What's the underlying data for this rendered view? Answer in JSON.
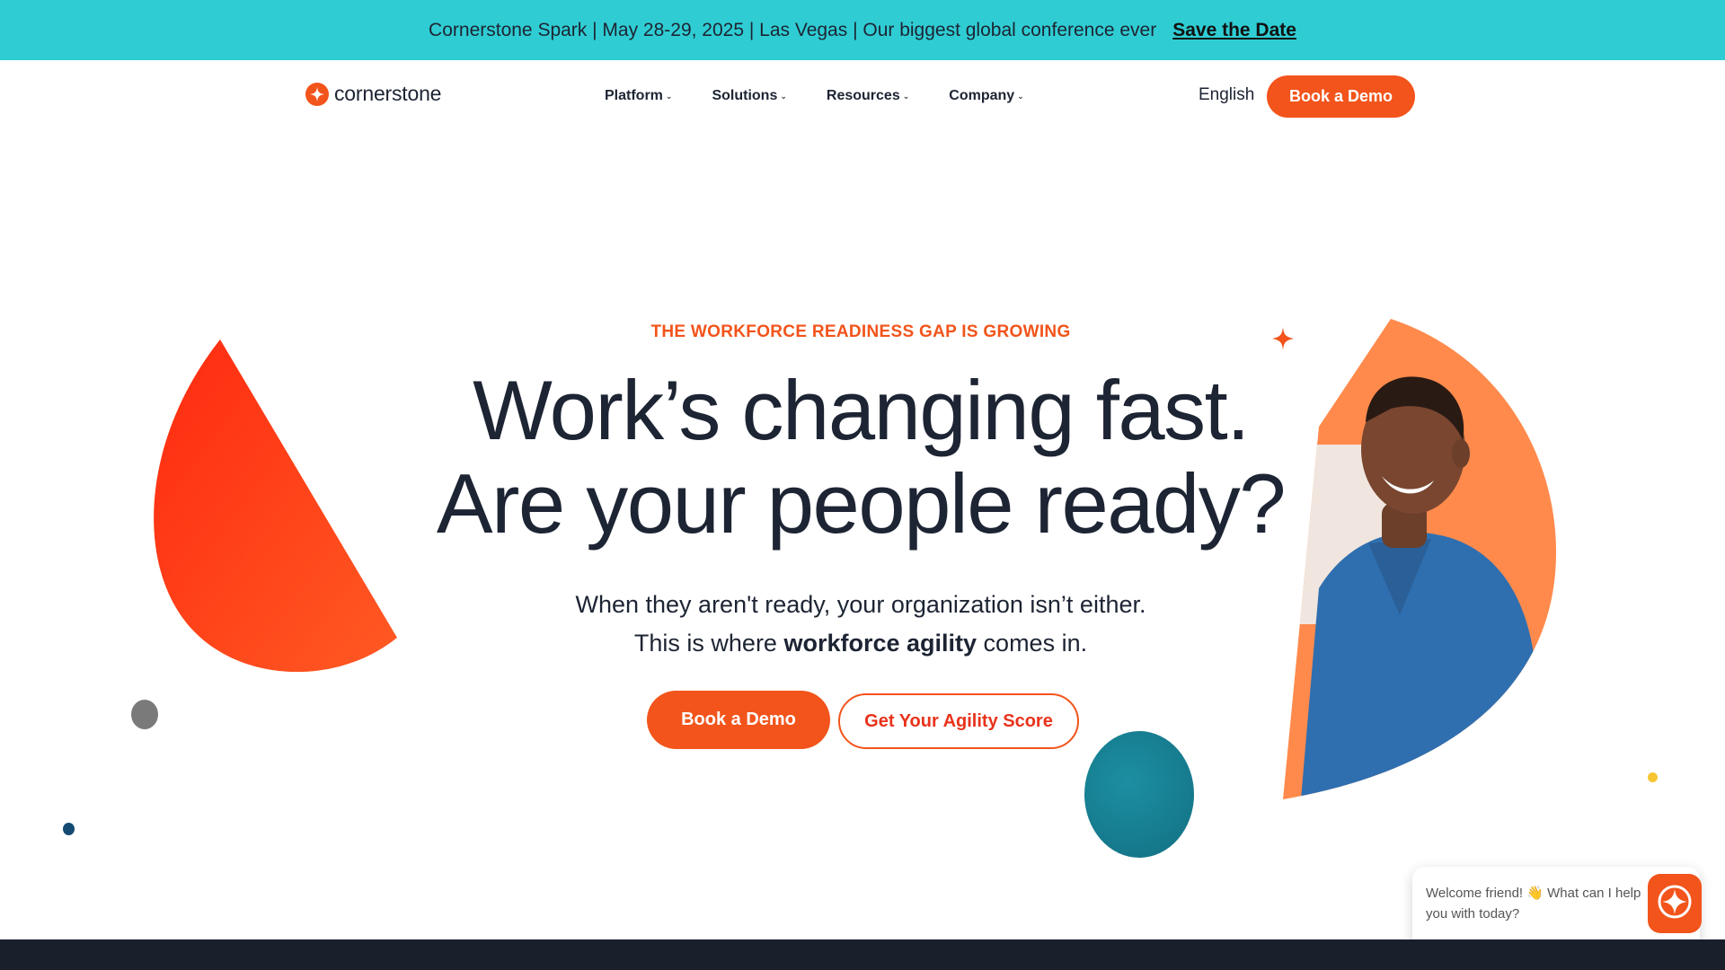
{
  "announcement": {
    "message": "Cornerstone Spark | May 28-29, 2025 | Las Vegas | Our biggest global conference ever",
    "link_label": "Save the Date"
  },
  "header": {
    "logo_text": "cornerstone",
    "nav": [
      {
        "label": "Platform"
      },
      {
        "label": "Solutions"
      },
      {
        "label": "Resources"
      },
      {
        "label": "Company"
      }
    ],
    "language": "English",
    "cta_label": "Book a Demo"
  },
  "hero": {
    "eyebrow": "THE WORKFORCE READINESS GAP IS GROWING",
    "headline_line1": "Work’s changing fast.",
    "headline_line2": "Are your people ready?",
    "sub_line1": "When they aren't ready, your organization isn’t either.",
    "sub_line2_pre": "This is where ",
    "sub_line2_bold": "workforce agility",
    "sub_line2_post": " comes in.",
    "primary_cta": "Book a Demo",
    "secondary_cta": "Get Your Agility Score"
  },
  "chat": {
    "message": "Welcome friend! 👋 What can I help you with today?"
  },
  "colors": {
    "accent": "#f2541b",
    "announcement_bg": "#2fcdd3",
    "text": "#1d2433",
    "teal": "#136f82"
  },
  "icons": {
    "logo": "cornerstone-star-icon",
    "chevron": "chevron-down-icon",
    "sparkle": "sparkle-icon",
    "chat": "cornerstone-star-icon"
  }
}
